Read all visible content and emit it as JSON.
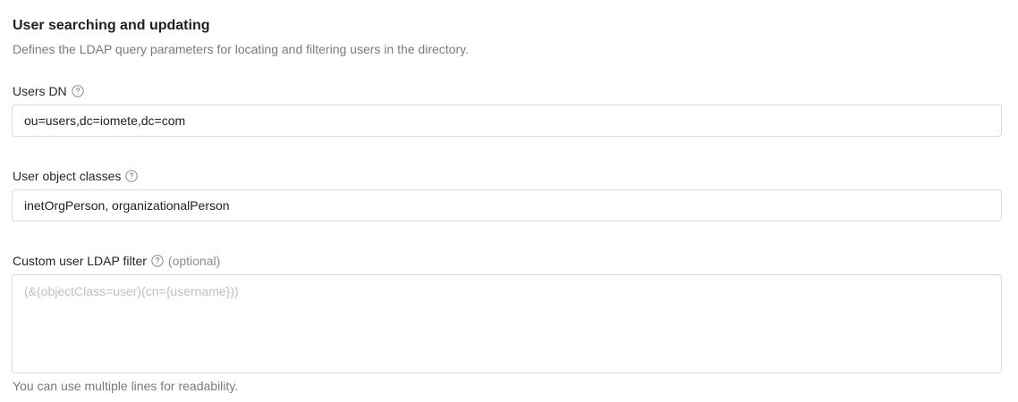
{
  "section": {
    "title": "User searching and updating",
    "description": "Defines the LDAP query parameters for locating and filtering users in the directory."
  },
  "fields": {
    "users_dn": {
      "label": "Users DN",
      "value": "ou=users,dc=iomete,dc=com"
    },
    "user_object_classes": {
      "label": "User object classes",
      "value": "inetOrgPerson, organizationalPerson"
    },
    "custom_filter": {
      "label": "Custom user LDAP filter",
      "optional": "(optional)",
      "placeholder": "(&(objectClass=user)(cn={username}))",
      "hint": "You can use multiple lines for readability."
    }
  },
  "icons": {
    "help": "question-circle-icon"
  },
  "colors": {
    "label_text": "#262626",
    "muted_text": "#7a7a7a",
    "border": "#d9d9d9",
    "placeholder": "#bfbfbf"
  }
}
